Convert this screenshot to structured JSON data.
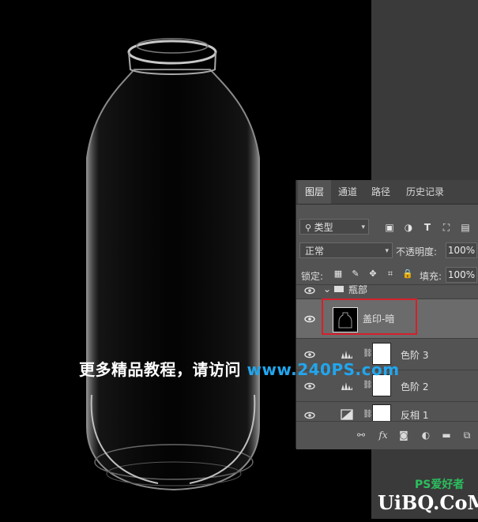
{
  "panel": {
    "tabs": [
      {
        "label": "图层",
        "active": true
      },
      {
        "label": "通道",
        "active": false
      },
      {
        "label": "路径",
        "active": false
      },
      {
        "label": "历史记录",
        "active": false
      }
    ],
    "filter": {
      "kind_label": "类型",
      "icons": [
        "image-filter-icon",
        "adjustment-filter-icon",
        "text-filter-icon",
        "shape-filter-icon",
        "smart-object-filter-icon"
      ]
    },
    "blend_mode": "正常",
    "opacity_label": "不透明度:",
    "opacity_value": "100%",
    "lock_label": "锁定:",
    "fill_label": "填充:",
    "fill_value": "100%",
    "group_name": "瓶部",
    "layers": [
      {
        "name": "盖印-暗",
        "type": "pixel",
        "selected": true
      },
      {
        "name": "色阶 3",
        "type": "levels",
        "selected": false
      },
      {
        "name": "色阶 2",
        "type": "levels",
        "selected": false
      },
      {
        "name": "反相 1",
        "type": "invert",
        "selected": false
      }
    ],
    "footer_icons": [
      "link-icon",
      "fx-icon",
      "mask-icon",
      "adjustment-icon",
      "folder-icon",
      "new-layer-icon"
    ],
    "footer_fx": "fx"
  },
  "overlay": {
    "text": "更多精品教程，请访问 ",
    "url": "www.240PS.com"
  },
  "watermark": {
    "main": "UiBQ.CoM",
    "sub": "PS爱好者"
  },
  "colors": {
    "accent_url": "#21a6ee",
    "selection_red": "#d6202c"
  }
}
